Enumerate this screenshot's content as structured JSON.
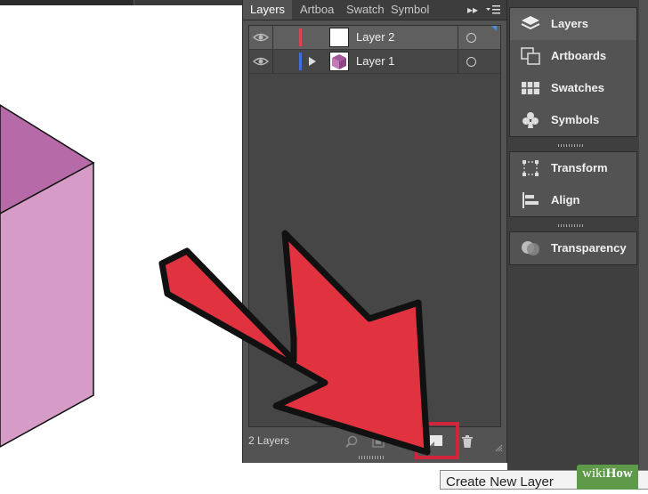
{
  "panel": {
    "tabs": [
      "Layers",
      "Artboa",
      "Swatch",
      "Symbol"
    ],
    "tab_more_icon": "double-chevron-right-icon",
    "tab_menu_icon": "panel-menu-icon"
  },
  "layers": [
    {
      "name": "Layer 2",
      "color": "#e0444e",
      "selected": true,
      "expandable": false
    },
    {
      "name": "Layer 1",
      "color": "#3f6fd8",
      "selected": false,
      "expandable": true
    }
  ],
  "footer": {
    "count_label": "2 Layers"
  },
  "dock": {
    "group1": [
      "Layers",
      "Artboards",
      "Swatches",
      "Symbols"
    ],
    "group2": [
      "Transform",
      "Align"
    ],
    "group3": [
      "Transparency"
    ]
  },
  "tooltip": "Create New Layer",
  "watermark": {
    "prefix": "wiki",
    "suffix": "How"
  },
  "colors": {
    "arrow": "#e0323f",
    "highlight": "#d0253a",
    "cube_top": "#b76aa8",
    "cube_front": "#d79bc7"
  }
}
